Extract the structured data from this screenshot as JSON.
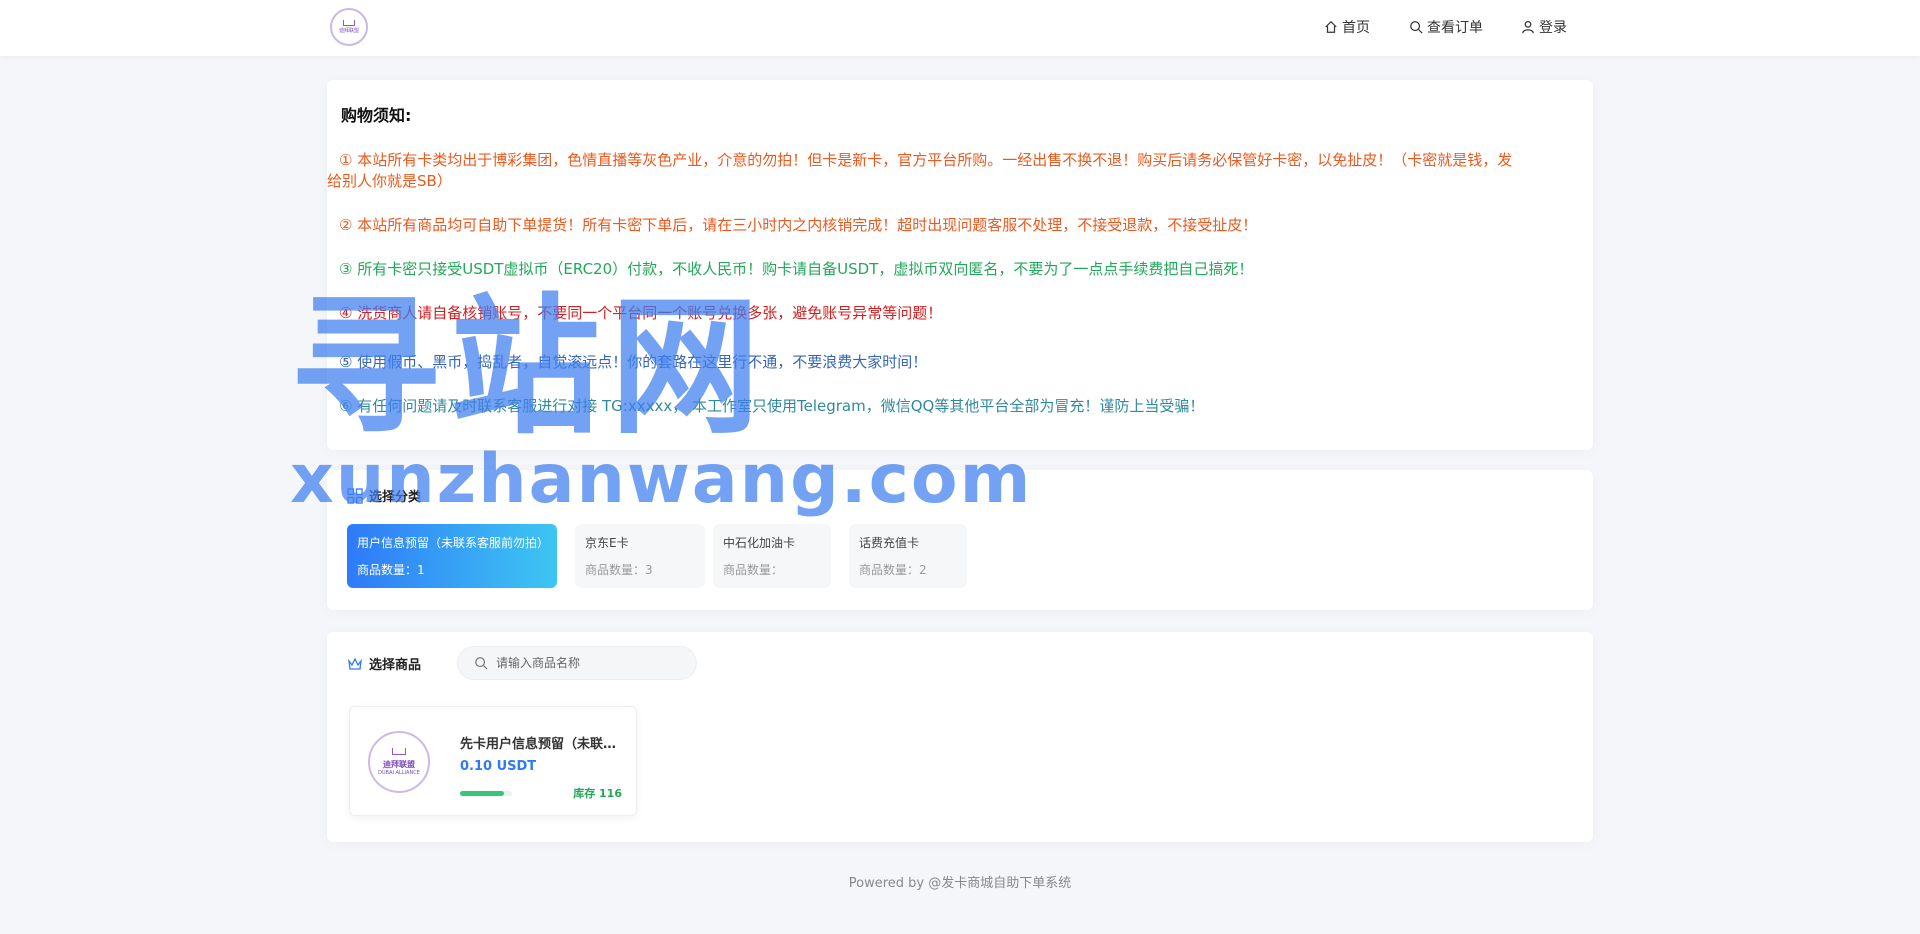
{
  "header": {
    "logo": {
      "text": "迪拜联盟",
      "icon": "crown-logo"
    },
    "nav": [
      {
        "label": "首页",
        "icon": "home-icon"
      },
      {
        "label": "查看订单",
        "icon": "search-icon"
      },
      {
        "label": "登录",
        "icon": "user-icon"
      }
    ]
  },
  "notice": {
    "title": "购物须知:",
    "items": [
      {
        "line1": "① 本站所有卡类均出于博彩集团，色情直播等灰色产业，介意的勿拍！但卡是新卡，官方平台所购。一经出售不换不退！购买后请务必保管好卡密，以免扯皮！（卡密就是钱，发",
        "line2": "给别人你就是SB）",
        "color": "#ea5a1f"
      },
      {
        "line1": "② 本站所有商品均可自助下单提货！所有卡密下单后，请在三小时内之内核销完成！超时出现问题客服不处理，不接受退款，不接受扯皮！",
        "color": "#ea5a1f"
      },
      {
        "line1": "③ 所有卡密只接受USDT虚拟币（ERC20）付款，不收人民币！购卡请自备USDT，虚拟币双向匿名，不要为了一点点手续费把自己搞死！",
        "color": "#23a85a"
      },
      {
        "line1": "④ 洗货商人请自备核销账号，不要同一个平台同一个账号兑换多张，避免账号异常等问题！",
        "color": "#d42020"
      },
      {
        "line1": "⑤ 使用假币、黑币，捣乱者，自觉滚远点！你的套路在这里行不通，不要浪费大家时间！",
        "color": "#3566b8"
      },
      {
        "line1": "⑥ 有任何问题请及时联系客服进行对接 TG:xxxxx， 本工作室只使用Telegram，微信QQ等其他平台全部为冒充！谨防上当受骗！",
        "color": "#2f8a9c"
      }
    ]
  },
  "category": {
    "title": "选择分类",
    "items": [
      {
        "name": "用户信息预留（未联系客服前勿拍）",
        "count": "商品数量：1",
        "active": true
      },
      {
        "name": "京东E卡",
        "count": "商品数量：3",
        "active": false
      },
      {
        "name": "中石化加油卡",
        "count": "商品数量：",
        "active": false
      },
      {
        "name": "话费充值卡",
        "count": "商品数量：2",
        "active": false
      }
    ]
  },
  "goods": {
    "title": "选择商品",
    "search_placeholder": "请输入商品名称",
    "products": [
      {
        "name": "先卡用户信息预留（未联系客服前勿拍）",
        "price": "0.10 USDT",
        "stock": "库存 116",
        "stock_fill": 0.85,
        "image_text": "迪拜联盟",
        "image_subtext": "DUBAI ALLIANCE"
      }
    ]
  },
  "footer": {
    "text": "Powered by @发卡商城自助下单系统"
  },
  "watermark": {
    "big": "寻站网",
    "small": "xunzhanwang.com"
  }
}
